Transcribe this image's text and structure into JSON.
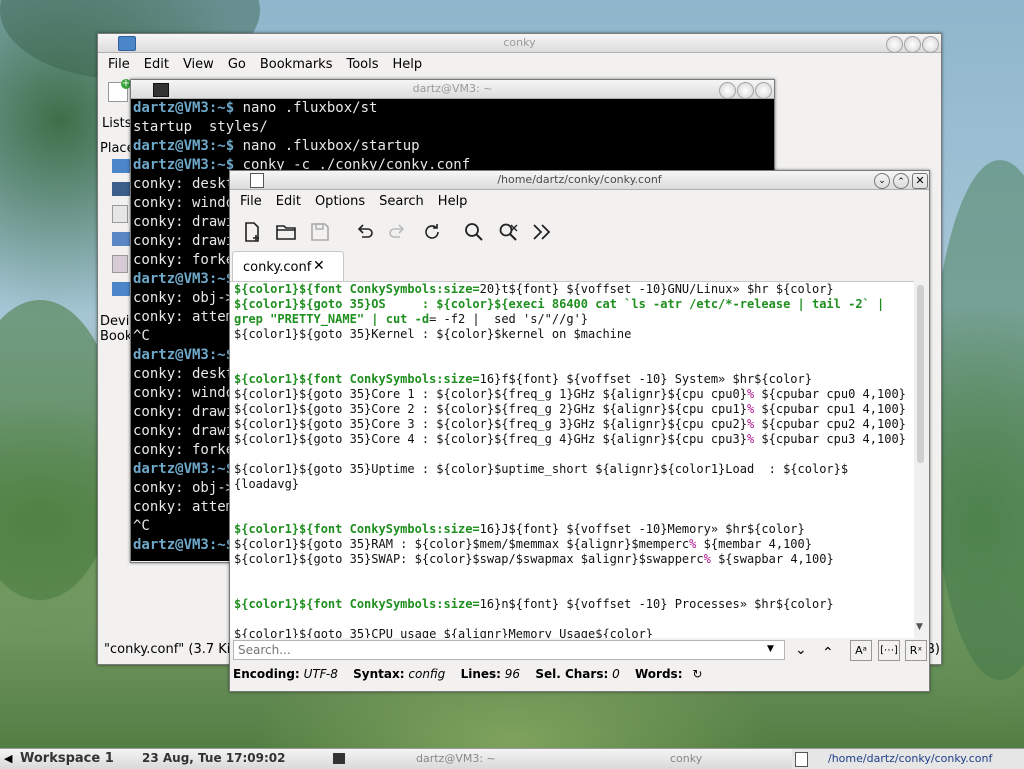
{
  "fm_window": {
    "title": "conky",
    "menu": [
      "File",
      "Edit",
      "View",
      "Go",
      "Bookmarks",
      "Tools",
      "Help"
    ],
    "side_tab": "Lists",
    "places_label": "Place",
    "devices_label": "Devic",
    "bookmarks_label": "Book",
    "status": "\"conky.conf\" (3.7 KiB",
    "status_tail": "B)"
  },
  "terminal": {
    "title": "dartz@VM3: ~",
    "lines": [
      {
        "prompt": "dartz@VM3:~$",
        "text": " nano .fluxbox/st"
      },
      {
        "prompt": "",
        "text": "startup  styles/"
      },
      {
        "prompt": "dartz@VM3:~$",
        "text": " nano .fluxbox/startup"
      },
      {
        "prompt": "dartz@VM3:~$",
        "text": " conky -c ./conky/conky.conf"
      },
      {
        "prompt": "",
        "text": "conky: deskt"
      },
      {
        "prompt": "",
        "text": "conky: windo"
      },
      {
        "prompt": "",
        "text": "conky: drawi"
      },
      {
        "prompt": "",
        "text": "conky: drawi"
      },
      {
        "prompt": "",
        "text": "conky: forke"
      },
      {
        "prompt": "dartz@VM3:~$",
        "text": ""
      },
      {
        "prompt": "",
        "text": "conky: obj->"
      },
      {
        "prompt": "",
        "text": "conky: attem"
      },
      {
        "prompt": "",
        "text": "^C"
      },
      {
        "prompt": "dartz@VM3:~$",
        "text": ""
      },
      {
        "prompt": "",
        "text": "conky: deskt"
      },
      {
        "prompt": "",
        "text": "conky: windo"
      },
      {
        "prompt": "",
        "text": "conky: drawi"
      },
      {
        "prompt": "",
        "text": "conky: drawi"
      },
      {
        "prompt": "",
        "text": "conky: forke"
      },
      {
        "prompt": "dartz@VM3:~$",
        "text": ""
      },
      {
        "prompt": "",
        "text": "conky: obj->"
      },
      {
        "prompt": "",
        "text": "conky: attem"
      },
      {
        "prompt": "",
        "text": "^C"
      },
      {
        "prompt": "dartz@VM3:~$",
        "text": ""
      }
    ]
  },
  "editor": {
    "title": "/home/dartz/conky/conky.conf",
    "menu": [
      "File",
      "Edit",
      "Options",
      "Search",
      "Help"
    ],
    "tab_label": "conky.conf",
    "code_lines": [
      [
        {
          "t": "${color1}${font ConkySymbols:size=",
          "c": "g"
        },
        {
          "t": "20}t${font} ${voffset -10}GNU/Linux» $hr ${color}",
          "c": ""
        }
      ],
      [
        {
          "t": "${color1}${goto 35}OS     : ${color}${execi 86400 cat `ls -atr /etc/*-release | tail -2` |",
          "c": "g"
        }
      ],
      [
        {
          "t": "grep \"PRETTY_NAME\" | cut -d",
          "c": "g"
        },
        {
          "t": "= -f2 |  sed 's/\"//g'}",
          "c": ""
        }
      ],
      [
        {
          "t": "${color1}${goto 35}Kernel : ${color}$kernel on $machine",
          "c": ""
        }
      ],
      [
        {
          "t": "",
          "c": ""
        }
      ],
      [
        {
          "t": "",
          "c": ""
        }
      ],
      [
        {
          "t": "${color1}${font ConkySymbols:size=",
          "c": "g"
        },
        {
          "t": "16}f${font} ${voffset -10} System» $hr${color}",
          "c": ""
        }
      ],
      [
        {
          "t": "${color1}${goto 35}Core 1 : ${color}${freq_g 1}GHz ${alignr}${cpu cpu0}",
          "c": ""
        },
        {
          "t": "%",
          "c": "m"
        },
        {
          "t": " ${cpubar cpu0 4,100}",
          "c": ""
        }
      ],
      [
        {
          "t": "${color1}${goto 35}Core 2 : ${color}${freq_g 2}GHz ${alignr}${cpu cpu1}",
          "c": ""
        },
        {
          "t": "%",
          "c": "m"
        },
        {
          "t": " ${cpubar cpu1 4,100}",
          "c": ""
        }
      ],
      [
        {
          "t": "${color1}${goto 35}Core 3 : ${color}${freq_g 3}GHz ${alignr}${cpu cpu2}",
          "c": ""
        },
        {
          "t": "%",
          "c": "m"
        },
        {
          "t": " ${cpubar cpu2 4,100}",
          "c": ""
        }
      ],
      [
        {
          "t": "${color1}${goto 35}Core 4 : ${color}${freq_g 4}GHz ${alignr}${cpu cpu3}",
          "c": ""
        },
        {
          "t": "%",
          "c": "m"
        },
        {
          "t": " ${cpubar cpu3 4,100}",
          "c": ""
        }
      ],
      [
        {
          "t": "",
          "c": ""
        }
      ],
      [
        {
          "t": "${color1}${goto 35}Uptime : ${color}$uptime_short ${alignr}${color1}Load  : ${color}$",
          "c": ""
        }
      ],
      [
        {
          "t": "{loadavg}",
          "c": ""
        }
      ],
      [
        {
          "t": "",
          "c": ""
        }
      ],
      [
        {
          "t": "",
          "c": ""
        }
      ],
      [
        {
          "t": "${color1}${font ConkySymbols:size=",
          "c": "g"
        },
        {
          "t": "16}J${font} ${voffset -10}Memory» $hr${color}",
          "c": ""
        }
      ],
      [
        {
          "t": "${color1}${goto 35}RAM : ${color}$mem/$memmax ${alignr}$memperc",
          "c": ""
        },
        {
          "t": "%",
          "c": "m"
        },
        {
          "t": " ${membar 4,100}",
          "c": ""
        }
      ],
      [
        {
          "t": "${color1}${goto 35}SWAP: ${color}$swap/$swapmax $alignr}$swapperc",
          "c": ""
        },
        {
          "t": "%",
          "c": "m"
        },
        {
          "t": " ${swapbar 4,100}",
          "c": ""
        }
      ],
      [
        {
          "t": "",
          "c": ""
        }
      ],
      [
        {
          "t": "",
          "c": ""
        }
      ],
      [
        {
          "t": "${color1}${font ConkySymbols:size=",
          "c": "g"
        },
        {
          "t": "16}n${font} ${voffset -10} Processes» $hr${color}",
          "c": ""
        }
      ],
      [
        {
          "t": "",
          "c": ""
        }
      ],
      [
        {
          "t": "${color1}${goto 35}CPU usage ${alignr}Memory Usage${color}",
          "c": ""
        }
      ]
    ],
    "search_placeholder": "Search...",
    "status": {
      "encoding_label": "Encoding:",
      "encoding_value": "UTF-8",
      "syntax_label": "Syntax:",
      "syntax_value": "config",
      "lines_label": "Lines:",
      "lines_value": "96",
      "selchars_label": "Sel. Chars:",
      "selchars_value": "0",
      "words_label": "Words:"
    }
  },
  "taskbar": {
    "workspace": "Workspace 1",
    "clock": "23 Aug, Tue 17:09:02",
    "tasks": [
      "dartz@VM3: ~",
      "conky",
      "/home/dartz/conky/conky.conf"
    ]
  }
}
